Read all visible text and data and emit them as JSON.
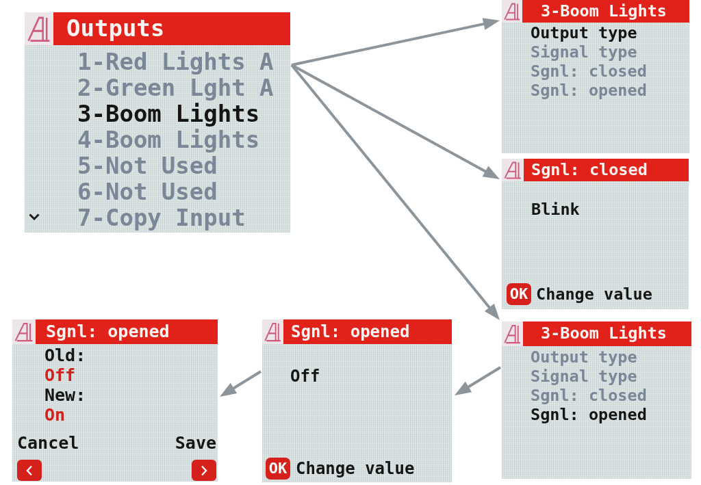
{
  "screens": [
    {
      "kind": "menu",
      "title": "Outputs",
      "items": [
        {
          "label": "1-Red Lights A",
          "selected": false
        },
        {
          "label": "2-Green Lght A",
          "selected": false
        },
        {
          "label": "3-Boom Lights",
          "selected": true
        },
        {
          "label": "4-Boom Lights",
          "selected": false
        },
        {
          "label": "5-Not Used",
          "selected": false
        },
        {
          "label": "6-Not Used",
          "selected": false
        },
        {
          "label": "7-Copy Input",
          "selected": false
        }
      ],
      "more_below": true
    },
    {
      "kind": "menu",
      "title": "3-Boom Lights",
      "items": [
        {
          "label": "Output type",
          "selected": true
        },
        {
          "label": "Signal type",
          "selected": false
        },
        {
          "label": "Sgnl: closed",
          "selected": false
        },
        {
          "label": "Sgnl: opened",
          "selected": false
        }
      ]
    },
    {
      "kind": "value",
      "title": "Sgnl: closed",
      "value": "Blink",
      "key": "OK",
      "hint": "Change value"
    },
    {
      "kind": "confirm",
      "title": "Sgnl: opened",
      "old_label": "Old:",
      "old_value": "Off",
      "new_label": "New:",
      "new_value": "On",
      "cancel_label": "Cancel",
      "save_label": "Save"
    },
    {
      "kind": "value",
      "title": "Sgnl: opened",
      "value": "Off",
      "key": "OK",
      "hint": "Change value"
    },
    {
      "kind": "menu",
      "title": "3-Boom Lights",
      "items": [
        {
          "label": "Output type",
          "selected": false
        },
        {
          "label": "Signal type",
          "selected": false
        },
        {
          "label": "Sgnl: closed",
          "selected": false
        },
        {
          "label": "Sgnl: opened",
          "selected": true
        }
      ]
    }
  ]
}
